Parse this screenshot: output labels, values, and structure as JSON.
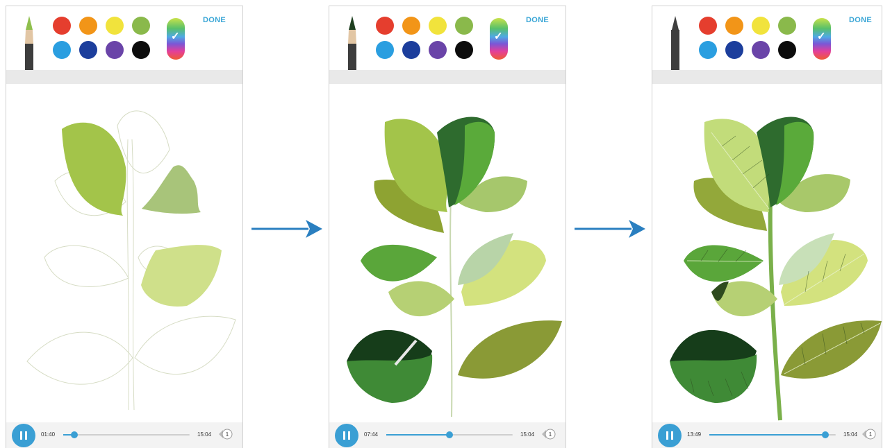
{
  "screens": [
    {
      "done_label": "DONE",
      "current_time": "01:40",
      "total_time": "15:04",
      "progress": 0.09,
      "speed_label": "1",
      "stage": "sketch"
    },
    {
      "done_label": "DONE",
      "current_time": "07:44",
      "total_time": "15:04",
      "progress": 0.5,
      "speed_label": "1",
      "stage": "colored"
    },
    {
      "done_label": "DONE",
      "current_time": "13:49",
      "total_time": "15:04",
      "progress": 0.92,
      "speed_label": "1",
      "stage": "veined"
    }
  ],
  "palette": [
    "#e53e2e",
    "#f29518",
    "#f1e33c",
    "#8ab94b",
    "#2a9ee0",
    "#1c3e9c",
    "#6a44a8",
    "#0c0c0c"
  ],
  "pen_colors": [
    "#8fbf4d",
    "#1f3f20",
    "#3f3f3f"
  ],
  "accent_color": "#3a9fd4",
  "arrow_color": "#2a7fc0",
  "icons": {
    "play_pause": "pause-icon",
    "speed": "playback-speed-icon",
    "picker_check": "check-icon",
    "arrow": "arrow-right-icon"
  }
}
